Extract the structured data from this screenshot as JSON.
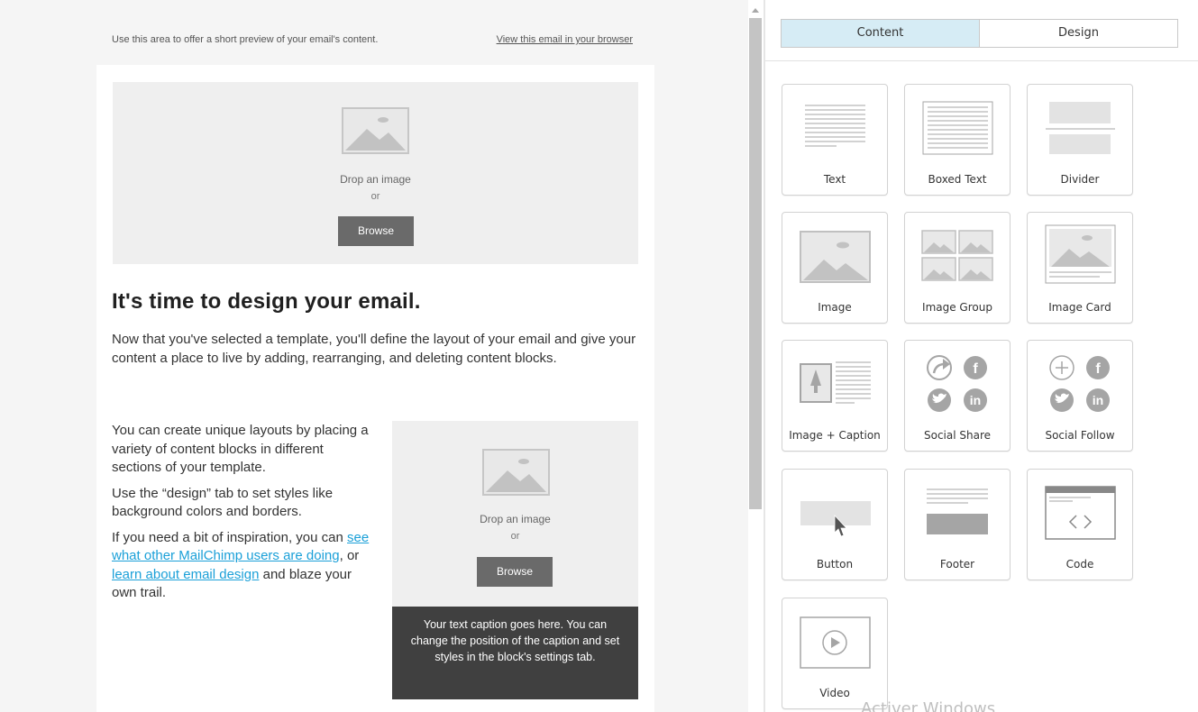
{
  "preheader": {
    "text": "Use this area to offer a short preview of your email's content.",
    "view_link": "View this email in your browser"
  },
  "hero_image": {
    "drop_label": "Drop an image",
    "or_label": "or",
    "browse_label": "Browse"
  },
  "headline": "It's time to design your email.",
  "intro": "Now that you've selected a template, you'll define the layout of your email and give your content a place to live by adding, rearranging, and deleting content blocks.",
  "column": {
    "p1": "You can create unique layouts by placing a variety of content blocks in different sections of your template.",
    "p2": "Use the “design” tab to set styles like background colors and borders.",
    "p3_start": "If you need a bit of inspiration, you can ",
    "link1": "see what other MailChimp users are doing",
    "p3_mid": ", or ",
    "link2": "learn about email design",
    "p3_end": " and blaze your own trail."
  },
  "caption_image": {
    "drop_label": "Drop an image",
    "or_label": "or",
    "browse_label": "Browse",
    "caption": "Your text caption goes here. You can change the position of the caption and set styles in the block's settings tab."
  },
  "tabs": {
    "content": "Content",
    "design": "Design"
  },
  "blocks": {
    "text": "Text",
    "boxed_text": "Boxed Text",
    "divider": "Divider",
    "image": "Image",
    "image_group": "Image Group",
    "image_card": "Image Card",
    "image_caption": "Image + Caption",
    "social_share": "Social Share",
    "social_follow": "Social Follow",
    "button": "Button",
    "footer": "Footer",
    "code": "Code",
    "video": "Video"
  },
  "watermark": "Activer Windows",
  "colors": {
    "tab_active": "#d6ecf5",
    "link": "#1ba0d8",
    "caption_bg": "#404040",
    "browse_bg": "#6a6a6a"
  }
}
